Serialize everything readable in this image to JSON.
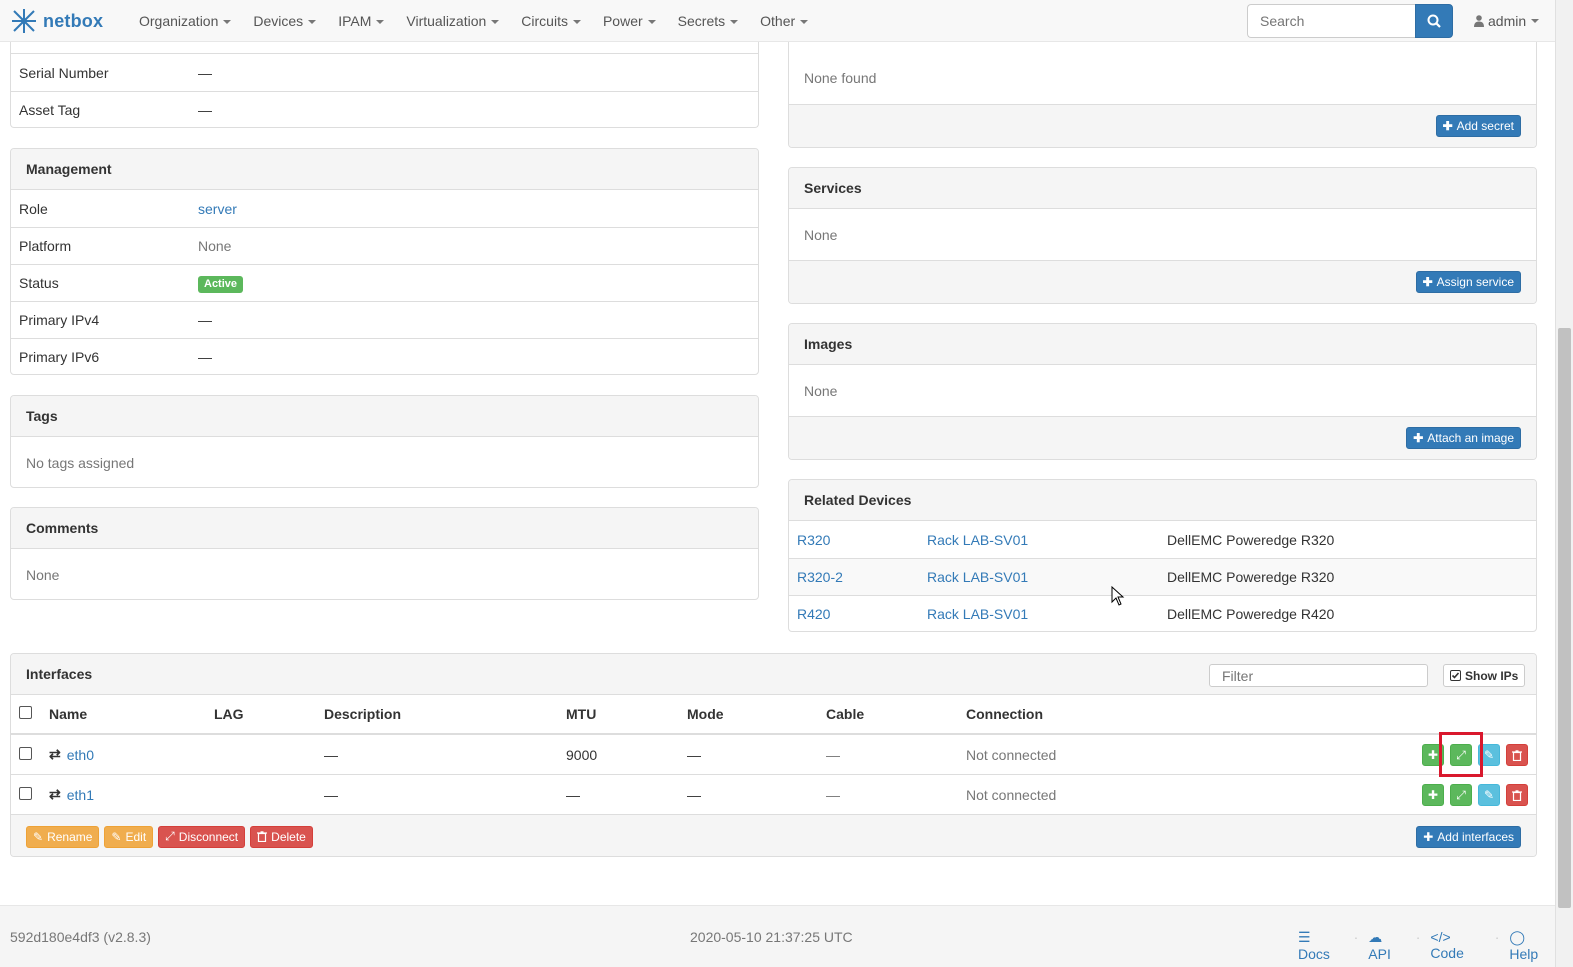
{
  "brand": {
    "name": "netbox"
  },
  "nav": {
    "items": [
      "Organization",
      "Devices",
      "IPAM",
      "Virtualization",
      "Circuits",
      "Power",
      "Secrets",
      "Other"
    ],
    "search_placeholder": "Search",
    "user": "admin"
  },
  "device_info": {
    "rows": [
      {
        "key": "Serial Number",
        "value": "—"
      },
      {
        "key": "Asset Tag",
        "value": "—"
      }
    ]
  },
  "management": {
    "title": "Management",
    "role_label": "Role",
    "role_value": "server",
    "platform_label": "Platform",
    "platform_value": "None",
    "status_label": "Status",
    "status_value": "Active",
    "ipv4_label": "Primary IPv4",
    "ipv4_value": "—",
    "ipv6_label": "Primary IPv6",
    "ipv6_value": "—"
  },
  "tags": {
    "title": "Tags",
    "body": "No tags assigned"
  },
  "comments": {
    "title": "Comments",
    "body": "None"
  },
  "secrets": {
    "body": "None found",
    "button": "Add secret"
  },
  "services": {
    "title": "Services",
    "body": "None",
    "button": "Assign service"
  },
  "images": {
    "title": "Images",
    "body": "None",
    "button": "Attach an image"
  },
  "related_devices": {
    "title": "Related Devices",
    "rows": [
      {
        "name": "R320",
        "rack": "Rack LAB-SV01",
        "type": "DellEMC Poweredge R320"
      },
      {
        "name": "R320-2",
        "rack": "Rack LAB-SV01",
        "type": "DellEMC Poweredge R320"
      },
      {
        "name": "R420",
        "rack": "Rack LAB-SV01",
        "type": "DellEMC Poweredge R420"
      }
    ]
  },
  "interfaces": {
    "title": "Interfaces",
    "filter_placeholder": "Filter",
    "show_ips": "Show IPs",
    "columns": [
      "Name",
      "LAG",
      "Description",
      "MTU",
      "Mode",
      "Cable",
      "Connection"
    ],
    "rows": [
      {
        "name": "eth0",
        "lag": "",
        "description": "—",
        "mtu": "9000",
        "mode": "—",
        "cable": "—",
        "connection": "Not connected"
      },
      {
        "name": "eth1",
        "lag": "",
        "description": "—",
        "mtu": "—",
        "mode": "—",
        "cable": "—",
        "connection": "Not connected"
      }
    ],
    "actions": {
      "rename": "Rename",
      "edit": "Edit",
      "disconnect": "Disconnect",
      "delete": "Delete",
      "add": "Add interfaces"
    }
  },
  "footer": {
    "version": "592d180e4df3 (v2.8.3)",
    "timestamp": "2020-05-10 21:37:25 UTC",
    "links": [
      "Docs",
      "API",
      "Code",
      "Help"
    ]
  },
  "colors": {
    "primary": "#337ab7",
    "success": "#5cb85c",
    "danger": "#d9534f",
    "warning": "#f0ad4e",
    "info": "#5bc0de",
    "highlight": "#d9182d"
  }
}
